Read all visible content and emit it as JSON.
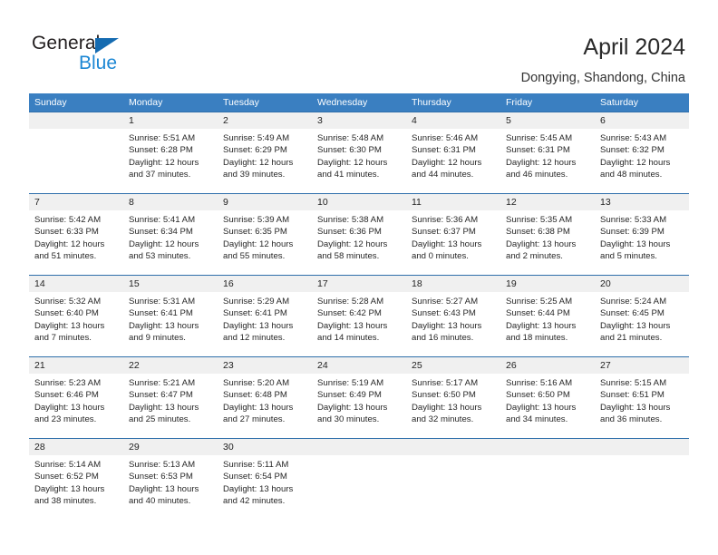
{
  "brand": {
    "name_top": "General",
    "name_bottom": "Blue",
    "triangle_color": "#156BB1",
    "blue_text_color": "#1C87D4"
  },
  "header": {
    "title": "April 2024",
    "subtitle": "Dongying, Shandong, China"
  },
  "theme": {
    "header_row_bg": "#3A7FC1",
    "header_row_text": "#FFFFFF",
    "daynum_row_bg": "#F0F0F0",
    "week_divider": "#2F6FAB",
    "body_text": "#272727"
  },
  "weekdays": [
    "Sunday",
    "Monday",
    "Tuesday",
    "Wednesday",
    "Thursday",
    "Friday",
    "Saturday"
  ],
  "weeks": [
    {
      "numbers": [
        "",
        "1",
        "2",
        "3",
        "4",
        "5",
        "6"
      ],
      "cells": [
        {
          "sunrise": "",
          "sunset": "",
          "daylight1": "",
          "daylight2": ""
        },
        {
          "sunrise": "Sunrise: 5:51 AM",
          "sunset": "Sunset: 6:28 PM",
          "daylight1": "Daylight: 12 hours",
          "daylight2": "and 37 minutes."
        },
        {
          "sunrise": "Sunrise: 5:49 AM",
          "sunset": "Sunset: 6:29 PM",
          "daylight1": "Daylight: 12 hours",
          "daylight2": "and 39 minutes."
        },
        {
          "sunrise": "Sunrise: 5:48 AM",
          "sunset": "Sunset: 6:30 PM",
          "daylight1": "Daylight: 12 hours",
          "daylight2": "and 41 minutes."
        },
        {
          "sunrise": "Sunrise: 5:46 AM",
          "sunset": "Sunset: 6:31 PM",
          "daylight1": "Daylight: 12 hours",
          "daylight2": "and 44 minutes."
        },
        {
          "sunrise": "Sunrise: 5:45 AM",
          "sunset": "Sunset: 6:31 PM",
          "daylight1": "Daylight: 12 hours",
          "daylight2": "and 46 minutes."
        },
        {
          "sunrise": "Sunrise: 5:43 AM",
          "sunset": "Sunset: 6:32 PM",
          "daylight1": "Daylight: 12 hours",
          "daylight2": "and 48 minutes."
        }
      ]
    },
    {
      "numbers": [
        "7",
        "8",
        "9",
        "10",
        "11",
        "12",
        "13"
      ],
      "cells": [
        {
          "sunrise": "Sunrise: 5:42 AM",
          "sunset": "Sunset: 6:33 PM",
          "daylight1": "Daylight: 12 hours",
          "daylight2": "and 51 minutes."
        },
        {
          "sunrise": "Sunrise: 5:41 AM",
          "sunset": "Sunset: 6:34 PM",
          "daylight1": "Daylight: 12 hours",
          "daylight2": "and 53 minutes."
        },
        {
          "sunrise": "Sunrise: 5:39 AM",
          "sunset": "Sunset: 6:35 PM",
          "daylight1": "Daylight: 12 hours",
          "daylight2": "and 55 minutes."
        },
        {
          "sunrise": "Sunrise: 5:38 AM",
          "sunset": "Sunset: 6:36 PM",
          "daylight1": "Daylight: 12 hours",
          "daylight2": "and 58 minutes."
        },
        {
          "sunrise": "Sunrise: 5:36 AM",
          "sunset": "Sunset: 6:37 PM",
          "daylight1": "Daylight: 13 hours",
          "daylight2": "and 0 minutes."
        },
        {
          "sunrise": "Sunrise: 5:35 AM",
          "sunset": "Sunset: 6:38 PM",
          "daylight1": "Daylight: 13 hours",
          "daylight2": "and 2 minutes."
        },
        {
          "sunrise": "Sunrise: 5:33 AM",
          "sunset": "Sunset: 6:39 PM",
          "daylight1": "Daylight: 13 hours",
          "daylight2": "and 5 minutes."
        }
      ]
    },
    {
      "numbers": [
        "14",
        "15",
        "16",
        "17",
        "18",
        "19",
        "20"
      ],
      "cells": [
        {
          "sunrise": "Sunrise: 5:32 AM",
          "sunset": "Sunset: 6:40 PM",
          "daylight1": "Daylight: 13 hours",
          "daylight2": "and 7 minutes."
        },
        {
          "sunrise": "Sunrise: 5:31 AM",
          "sunset": "Sunset: 6:41 PM",
          "daylight1": "Daylight: 13 hours",
          "daylight2": "and 9 minutes."
        },
        {
          "sunrise": "Sunrise: 5:29 AM",
          "sunset": "Sunset: 6:41 PM",
          "daylight1": "Daylight: 13 hours",
          "daylight2": "and 12 minutes."
        },
        {
          "sunrise": "Sunrise: 5:28 AM",
          "sunset": "Sunset: 6:42 PM",
          "daylight1": "Daylight: 13 hours",
          "daylight2": "and 14 minutes."
        },
        {
          "sunrise": "Sunrise: 5:27 AM",
          "sunset": "Sunset: 6:43 PM",
          "daylight1": "Daylight: 13 hours",
          "daylight2": "and 16 minutes."
        },
        {
          "sunrise": "Sunrise: 5:25 AM",
          "sunset": "Sunset: 6:44 PM",
          "daylight1": "Daylight: 13 hours",
          "daylight2": "and 18 minutes."
        },
        {
          "sunrise": "Sunrise: 5:24 AM",
          "sunset": "Sunset: 6:45 PM",
          "daylight1": "Daylight: 13 hours",
          "daylight2": "and 21 minutes."
        }
      ]
    },
    {
      "numbers": [
        "21",
        "22",
        "23",
        "24",
        "25",
        "26",
        "27"
      ],
      "cells": [
        {
          "sunrise": "Sunrise: 5:23 AM",
          "sunset": "Sunset: 6:46 PM",
          "daylight1": "Daylight: 13 hours",
          "daylight2": "and 23 minutes."
        },
        {
          "sunrise": "Sunrise: 5:21 AM",
          "sunset": "Sunset: 6:47 PM",
          "daylight1": "Daylight: 13 hours",
          "daylight2": "and 25 minutes."
        },
        {
          "sunrise": "Sunrise: 5:20 AM",
          "sunset": "Sunset: 6:48 PM",
          "daylight1": "Daylight: 13 hours",
          "daylight2": "and 27 minutes."
        },
        {
          "sunrise": "Sunrise: 5:19 AM",
          "sunset": "Sunset: 6:49 PM",
          "daylight1": "Daylight: 13 hours",
          "daylight2": "and 30 minutes."
        },
        {
          "sunrise": "Sunrise: 5:17 AM",
          "sunset": "Sunset: 6:50 PM",
          "daylight1": "Daylight: 13 hours",
          "daylight2": "and 32 minutes."
        },
        {
          "sunrise": "Sunrise: 5:16 AM",
          "sunset": "Sunset: 6:50 PM",
          "daylight1": "Daylight: 13 hours",
          "daylight2": "and 34 minutes."
        },
        {
          "sunrise": "Sunrise: 5:15 AM",
          "sunset": "Sunset: 6:51 PM",
          "daylight1": "Daylight: 13 hours",
          "daylight2": "and 36 minutes."
        }
      ]
    },
    {
      "numbers": [
        "28",
        "29",
        "30",
        "",
        "",
        "",
        ""
      ],
      "cells": [
        {
          "sunrise": "Sunrise: 5:14 AM",
          "sunset": "Sunset: 6:52 PM",
          "daylight1": "Daylight: 13 hours",
          "daylight2": "and 38 minutes."
        },
        {
          "sunrise": "Sunrise: 5:13 AM",
          "sunset": "Sunset: 6:53 PM",
          "daylight1": "Daylight: 13 hours",
          "daylight2": "and 40 minutes."
        },
        {
          "sunrise": "Sunrise: 5:11 AM",
          "sunset": "Sunset: 6:54 PM",
          "daylight1": "Daylight: 13 hours",
          "daylight2": "and 42 minutes."
        },
        {
          "sunrise": "",
          "sunset": "",
          "daylight1": "",
          "daylight2": ""
        },
        {
          "sunrise": "",
          "sunset": "",
          "daylight1": "",
          "daylight2": ""
        },
        {
          "sunrise": "",
          "sunset": "",
          "daylight1": "",
          "daylight2": ""
        },
        {
          "sunrise": "",
          "sunset": "",
          "daylight1": "",
          "daylight2": ""
        }
      ]
    }
  ]
}
